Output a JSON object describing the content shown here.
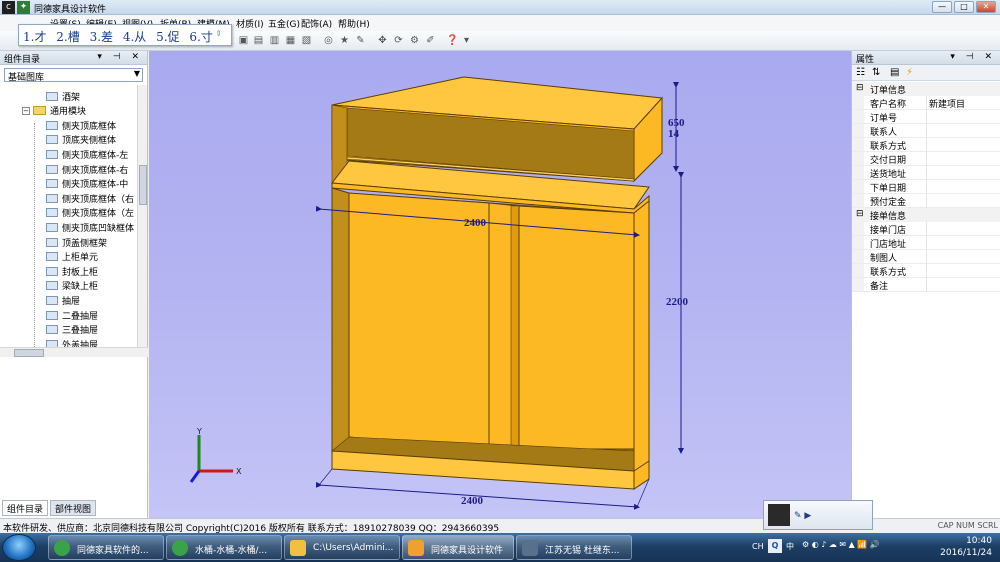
{
  "window": {
    "title": "同德家具设计软件",
    "buttons": [
      "—",
      "□",
      "✕"
    ]
  },
  "menubar": {
    "items": [
      "设置(S)",
      "编辑(E)",
      "视图(V)",
      "折单(B)",
      "建模(M)",
      "材质(I)",
      "五金(G)",
      "配饰(A)",
      "帮助(H)"
    ]
  },
  "ime": {
    "candidates": [
      "1.才",
      "2.槽",
      "3.差",
      "4.从",
      "5.促",
      "6.寸"
    ]
  },
  "left_panel": {
    "title": "组件目录",
    "library": "基础图库",
    "tree": [
      {
        "label": "酒架",
        "level": 2
      },
      {
        "label": "通用模块",
        "level": 1,
        "folder": true
      },
      {
        "label": "侧夹顶底框体",
        "level": 2
      },
      {
        "label": "顶底夹侧框体",
        "level": 2
      },
      {
        "label": "侧夹顶底框体-左",
        "level": 2
      },
      {
        "label": "侧夹顶底框体-右",
        "level": 2
      },
      {
        "label": "侧夹顶底框体-中",
        "level": 2
      },
      {
        "label": "侧夹顶底框体（右",
        "level": 2
      },
      {
        "label": "侧夹顶底框体（左",
        "level": 2
      },
      {
        "label": "侧夹顶底凹缺框体",
        "level": 2
      },
      {
        "label": "顶盖侧框架",
        "level": 2
      },
      {
        "label": "上柜单元",
        "level": 2
      },
      {
        "label": "封板上柜",
        "level": 2
      },
      {
        "label": "梁缺上柜",
        "level": 2
      },
      {
        "label": "抽屉",
        "level": 2
      },
      {
        "label": "二叠抽屉",
        "level": 2
      },
      {
        "label": "三叠抽屉",
        "level": 2
      },
      {
        "label": "外盖抽屉",
        "level": 2
      }
    ],
    "tabs": [
      "组件目录",
      "部件视图"
    ]
  },
  "viewport": {
    "dim_top": "650",
    "dim_gap": "14",
    "dim_width_mid": "2400",
    "dim_height": "2200",
    "dim_width_bottom": "2400",
    "axis_x": "X",
    "axis_y": "Y",
    "colors": {
      "panel": "#fdb924",
      "panel_dark": "#a47a16",
      "edge": "#5a3d00",
      "dim": "#1b1b8a"
    }
  },
  "right_panel": {
    "title": "属性",
    "categories": [
      {
        "name": "订单信息",
        "rows": [
          {
            "key": "客户名称",
            "value": "新建项目"
          },
          {
            "key": "订单号",
            "value": ""
          },
          {
            "key": "联系人",
            "value": ""
          },
          {
            "key": "联系方式",
            "value": ""
          },
          {
            "key": "交付日期",
            "value": ""
          },
          {
            "key": "送货地址",
            "value": ""
          },
          {
            "key": "下单日期",
            "value": ""
          },
          {
            "key": "预付定金",
            "value": ""
          }
        ]
      },
      {
        "name": "接单信息",
        "rows": [
          {
            "key": "接单门店",
            "value": ""
          },
          {
            "key": "门店地址",
            "value": ""
          },
          {
            "key": "制图人",
            "value": ""
          },
          {
            "key": "联系方式",
            "value": ""
          },
          {
            "key": "备注",
            "value": ""
          }
        ]
      }
    ]
  },
  "statusbar": {
    "text": "本软件研发、供应商：北京同德科技有限公司 Copyright(C)2016 版权所有 联系方式：18910278039 QQ：2943660395",
    "keys": "CAP  NUM  SCRL"
  },
  "taskbar": {
    "items": [
      {
        "label": "同德家具软件的..."
      },
      {
        "label": "水桶-水桶-水桶/..."
      },
      {
        "label": "C:\\Users\\Admini..."
      },
      {
        "label": "同德家具设计软件"
      },
      {
        "label": "江苏无锡 杜继东..."
      }
    ],
    "tray": {
      "ime": "CH",
      "lang": "中"
    },
    "clock": {
      "time": "10:40",
      "date": "2016/11/24"
    }
  }
}
